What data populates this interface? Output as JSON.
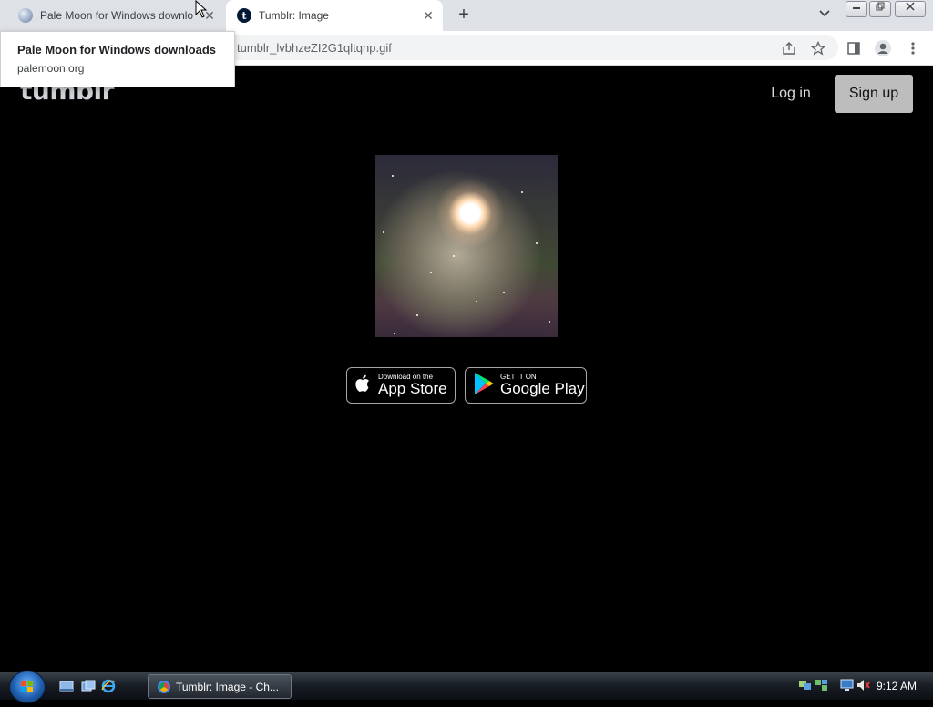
{
  "tabs": [
    {
      "title": "Pale Moon for Windows downlo",
      "favicon": "pale-moon-icon",
      "active": false
    },
    {
      "title": "Tumblr: Image",
      "favicon": "tumblr-icon",
      "active": true
    }
  ],
  "tooltip": {
    "title": "Pale Moon for Windows downloads",
    "url": "palemoon.org"
  },
  "address_bar": {
    "url": "tumblr_lvbhzeZI2G1qltqnp.gif"
  },
  "page": {
    "logo": "tumblr",
    "login_label": "Log in",
    "signup_label": "Sign up",
    "appstore_small": "Download on the",
    "appstore_big": "App Store",
    "googleplay_small": "GET IT ON",
    "googleplay_big": "Google Play"
  },
  "taskbar": {
    "task_label": "Tumblr: Image - Ch...",
    "clock": "9:12 AM"
  },
  "colors": {
    "page_bg": "#000000",
    "signup_bg": "#bdbdbd",
    "tabstrip_bg": "#dee1e6"
  }
}
